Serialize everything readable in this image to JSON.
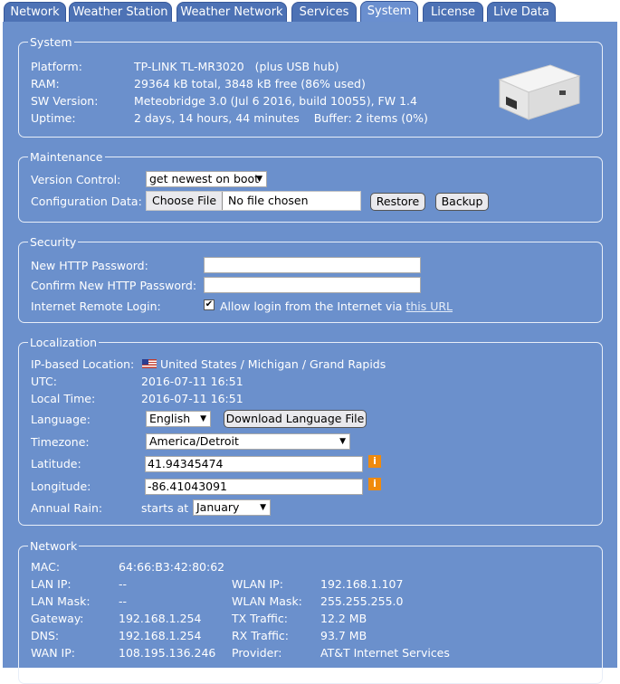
{
  "tabs": [
    "Network",
    "Weather Station",
    "Weather Network",
    "Services",
    "System",
    "License",
    "Live Data"
  ],
  "system": {
    "legend": "System",
    "platform_label": "Platform:",
    "platform": "TP-LINK TL-MR3020   (plus USB hub)",
    "ram_label": "RAM:",
    "ram": "29364 kB total, 3848 kB free (86% used)",
    "sw_label": "SW Version:",
    "sw": "Meteobridge 3.0 (Jul 6 2016, build 10055), FW 1.4",
    "uptime_label": "Uptime:",
    "uptime": "2 days, 14 hours, 44 minutes    Buffer: 2 items (0%)"
  },
  "maintenance": {
    "legend": "Maintenance",
    "version_label": "Version Control:",
    "version_value": "get newest on boot",
    "config_label": "Configuration Data:",
    "choose_file": "Choose File",
    "no_file": "No file chosen",
    "restore": "Restore",
    "backup": "Backup"
  },
  "security": {
    "legend": "Security",
    "new_pw_label": "New HTTP Password:",
    "confirm_pw_label": "Confirm New HTTP Password:",
    "remote_label": "Internet Remote Login:",
    "remote_text": "Allow login from the Internet via",
    "remote_link": "this URL",
    "remote_checked": true
  },
  "localization": {
    "legend": "Localization",
    "ip_loc_label": "IP-based Location:",
    "ip_loc": "United States / Michigan / Grand Rapids",
    "utc_label": "UTC:",
    "utc": "2016-07-11 16:51",
    "local_label": "Local Time:",
    "local": "2016-07-11 16:51",
    "language_label": "Language:",
    "language": "English",
    "download_lang": "Download Language File",
    "timezone_label": "Timezone:",
    "timezone": "America/Detroit",
    "latitude_label": "Latitude:",
    "latitude": "41.94345474",
    "longitude_label": "Longitude:",
    "longitude": "-86.41043091",
    "rain_label": "Annual Rain:",
    "rain_prefix": "starts at",
    "rain_month": "January",
    "info_glyph": "i"
  },
  "network": {
    "legend": "Network",
    "mac_label": "MAC:",
    "mac": "64:66:B3:42:80:62",
    "lan_ip_label": "LAN IP:",
    "lan_ip": "--",
    "lan_mask_label": "LAN Mask:",
    "lan_mask": "--",
    "gateway_label": "Gateway:",
    "gateway": "192.168.1.254",
    "dns_label": "DNS:",
    "dns": "192.168.1.254",
    "wan_ip_label": "WAN IP:",
    "wan_ip": "108.195.136.246",
    "wlan_ip_label": "WLAN IP:",
    "wlan_ip": "192.168.1.107",
    "wlan_mask_label": "WLAN Mask:",
    "wlan_mask": "255.255.255.0",
    "tx_label": "TX Traffic:",
    "tx": "12.2 MB",
    "rx_label": "RX Traffic:",
    "rx": "93.7 MB",
    "provider_label": "Provider:",
    "provider": "AT&T Internet Services"
  }
}
